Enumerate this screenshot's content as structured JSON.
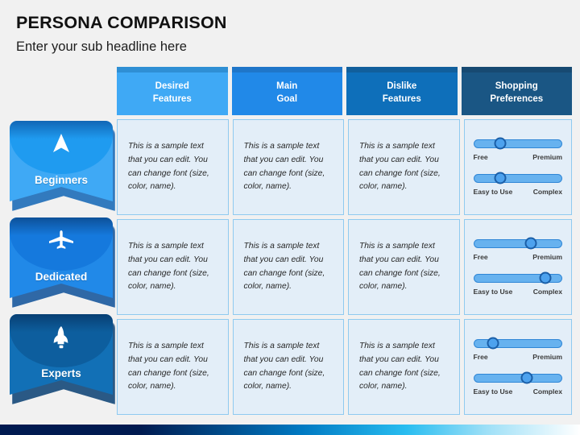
{
  "slide": {
    "title": "PERSONA COMPARISON",
    "subtitle": "Enter your sub headline here",
    "background_color": "#f1f1f1",
    "bottom_bar_gradient": [
      "#001a50",
      "#00356f",
      "#0079c2",
      "#29bdf0",
      "#9fe0f7",
      "#ffffff"
    ]
  },
  "table": {
    "columns": [
      {
        "label_line1": "Desired",
        "label_line2": "Features",
        "color": "#3fa9f5",
        "cap_color": "#2f8fd4"
      },
      {
        "label_line1": "Main",
        "label_line2": "Goal",
        "color": "#2189e8",
        "cap_color": "#1f76c9"
      },
      {
        "label_line1": "Dislike",
        "label_line2": "Features",
        "color": "#0e6fba",
        "cap_color": "#115f9c"
      },
      {
        "label_line1": "Shopping",
        "label_line2": "Preferences",
        "color": "#1a5684",
        "cap_color": "#174a72"
      }
    ],
    "cell_bg": "#e3eef8",
    "cell_border": "#8fcaf0",
    "sample_text": "This is a sample text that you can edit. You can change font (size, color, name)."
  },
  "personas": [
    {
      "label": "Beginners",
      "icon": "navigation-arrow-icon",
      "body_color": "#3fa9f5",
      "dome_color": "#1f9bf0",
      "shadow_color": "#1166b5",
      "sliders": [
        {
          "left_label": "Free",
          "right_label": "Premium",
          "value": 30
        },
        {
          "left_label": "Easy to Use",
          "right_label": "Complex",
          "value": 30
        }
      ]
    },
    {
      "label": "Dedicated",
      "icon": "airplane-icon",
      "body_color": "#2189e8",
      "dome_color": "#1579dd",
      "shadow_color": "#0d5199",
      "sliders": [
        {
          "left_label": "Free",
          "right_label": "Premium",
          "value": 65
        },
        {
          "left_label": "Easy to Use",
          "right_label": "Complex",
          "value": 82
        }
      ]
    },
    {
      "label": "Experts",
      "icon": "space-shuttle-icon",
      "body_color": "#1270b6",
      "dome_color": "#0d5e9e",
      "shadow_color": "#083f73",
      "sliders": [
        {
          "left_label": "Free",
          "right_label": "Premium",
          "value": 22
        },
        {
          "left_label": "Easy to Use",
          "right_label": "Complex",
          "value": 60
        }
      ]
    }
  ]
}
